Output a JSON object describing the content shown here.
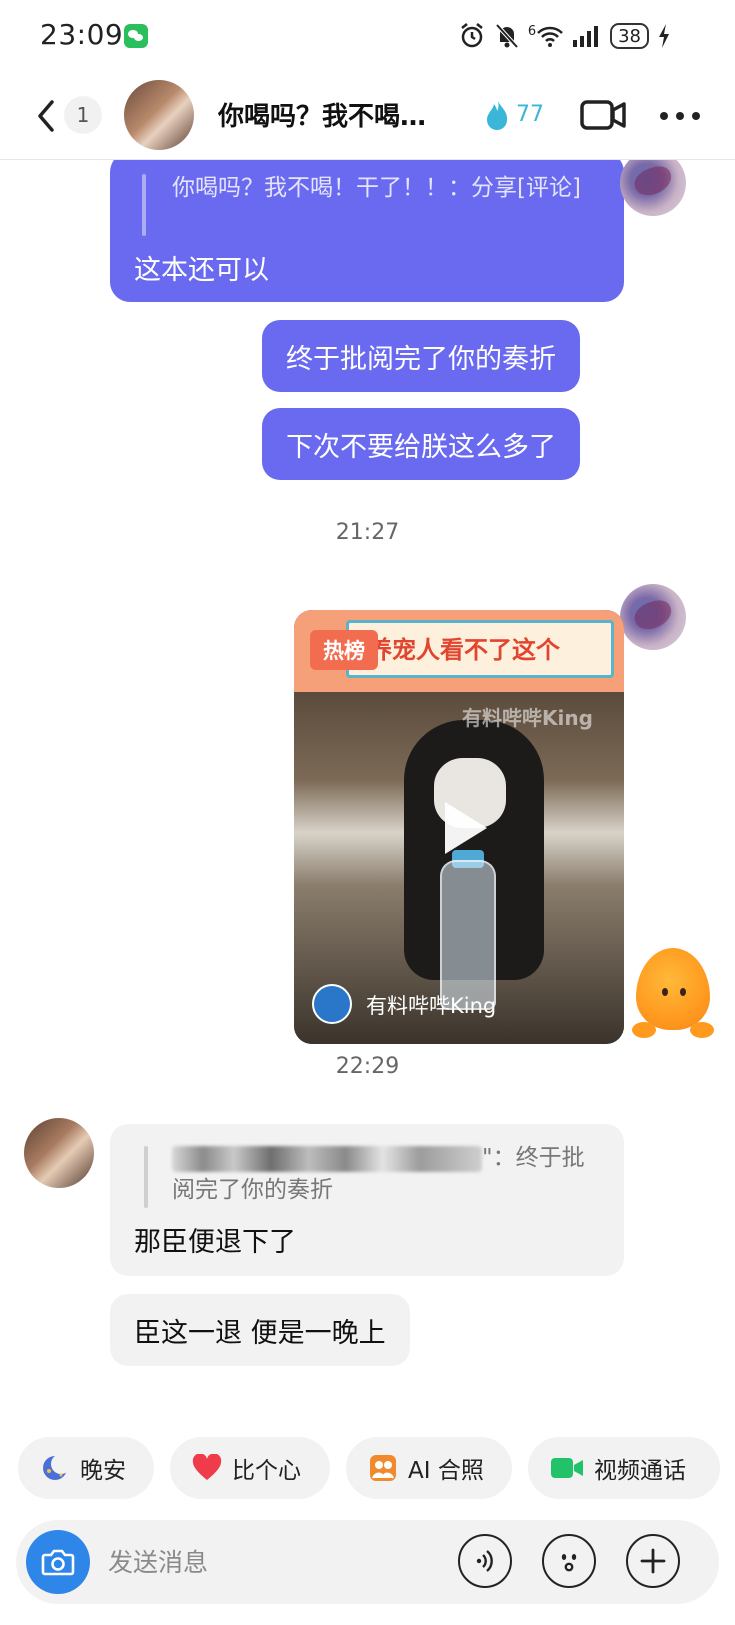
{
  "status_bar": {
    "time": "23:09",
    "battery_level": "38",
    "network_label": "6"
  },
  "header": {
    "unread_count": "1",
    "title": "你喝吗？我不喝…",
    "spark_count": "77"
  },
  "messages": {
    "quote_out": {
      "quote": "你喝吗？我不喝！干了！！：分享[评论]",
      "reply": "这本还可以"
    },
    "out_1": "终于批阅完了你的奏折",
    "out_2": "下次不要给朕这么多了",
    "time_1": "21:27",
    "video": {
      "hot_tag": "热榜",
      "banner_title": "养宠人看不了这个",
      "watermark": "有料哔哔King",
      "uploader": "有料哔哔King"
    },
    "time_2": "22:29",
    "quote_in": {
      "quote_suffix": "\"：终于批阅完了你的奏折",
      "reply": "那臣便退下了"
    },
    "in_1": "臣这一退 便是一晚上"
  },
  "quick_actions": [
    {
      "label": "晚安",
      "icon": "moon-icon"
    },
    {
      "label": "比个心",
      "icon": "heart-icon"
    },
    {
      "label": "AI 合照",
      "icon": "ai-photo-icon"
    },
    {
      "label": "视频通话",
      "icon": "video-camera-icon"
    }
  ],
  "input_bar": {
    "placeholder": "发送消息"
  },
  "colors": {
    "outgoing_bubble": "#6a6af0",
    "incoming_bubble": "#f2f2f2",
    "spark": "#3ab7d8",
    "camera_button": "#2d86e8"
  }
}
